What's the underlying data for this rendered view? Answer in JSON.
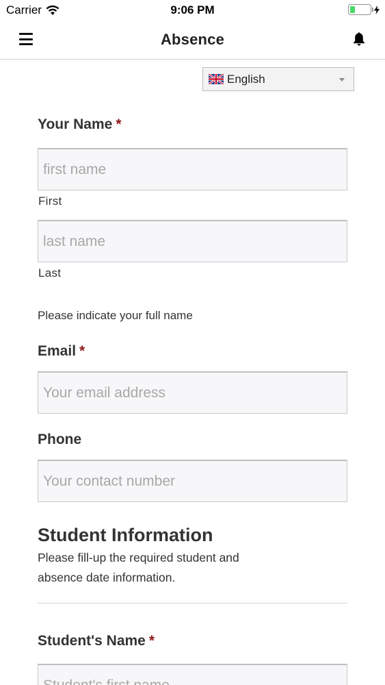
{
  "status_bar": {
    "carrier": "Carrier",
    "time": "9:06 PM",
    "battery_level": 0.25
  },
  "nav": {
    "title": "Absence",
    "left_icon": "hamburger-menu-icon",
    "right_icon": "bell-icon"
  },
  "language": {
    "selected": "English",
    "flag_icon": "uk-flag-icon"
  },
  "form": {
    "name_label": "Your Name",
    "required_mark": "*",
    "first_placeholder": "first name",
    "first_sublabel": "First",
    "last_placeholder": "last name",
    "last_sublabel": "Last",
    "name_help": "Please indicate your full name",
    "email_label": "Email",
    "email_placeholder": "Your email address",
    "phone_label": "Phone",
    "phone_placeholder": "Your contact number"
  },
  "student_section": {
    "title": "Student Information",
    "description": "Please fill-up the required student and absence date information.",
    "student_name_label": "Student's Name",
    "student_first_placeholder": "Student's first name"
  },
  "colors": {
    "required": "#8b1a1a",
    "battery": "#4cd964",
    "input_bg": "#f7f6f8"
  }
}
